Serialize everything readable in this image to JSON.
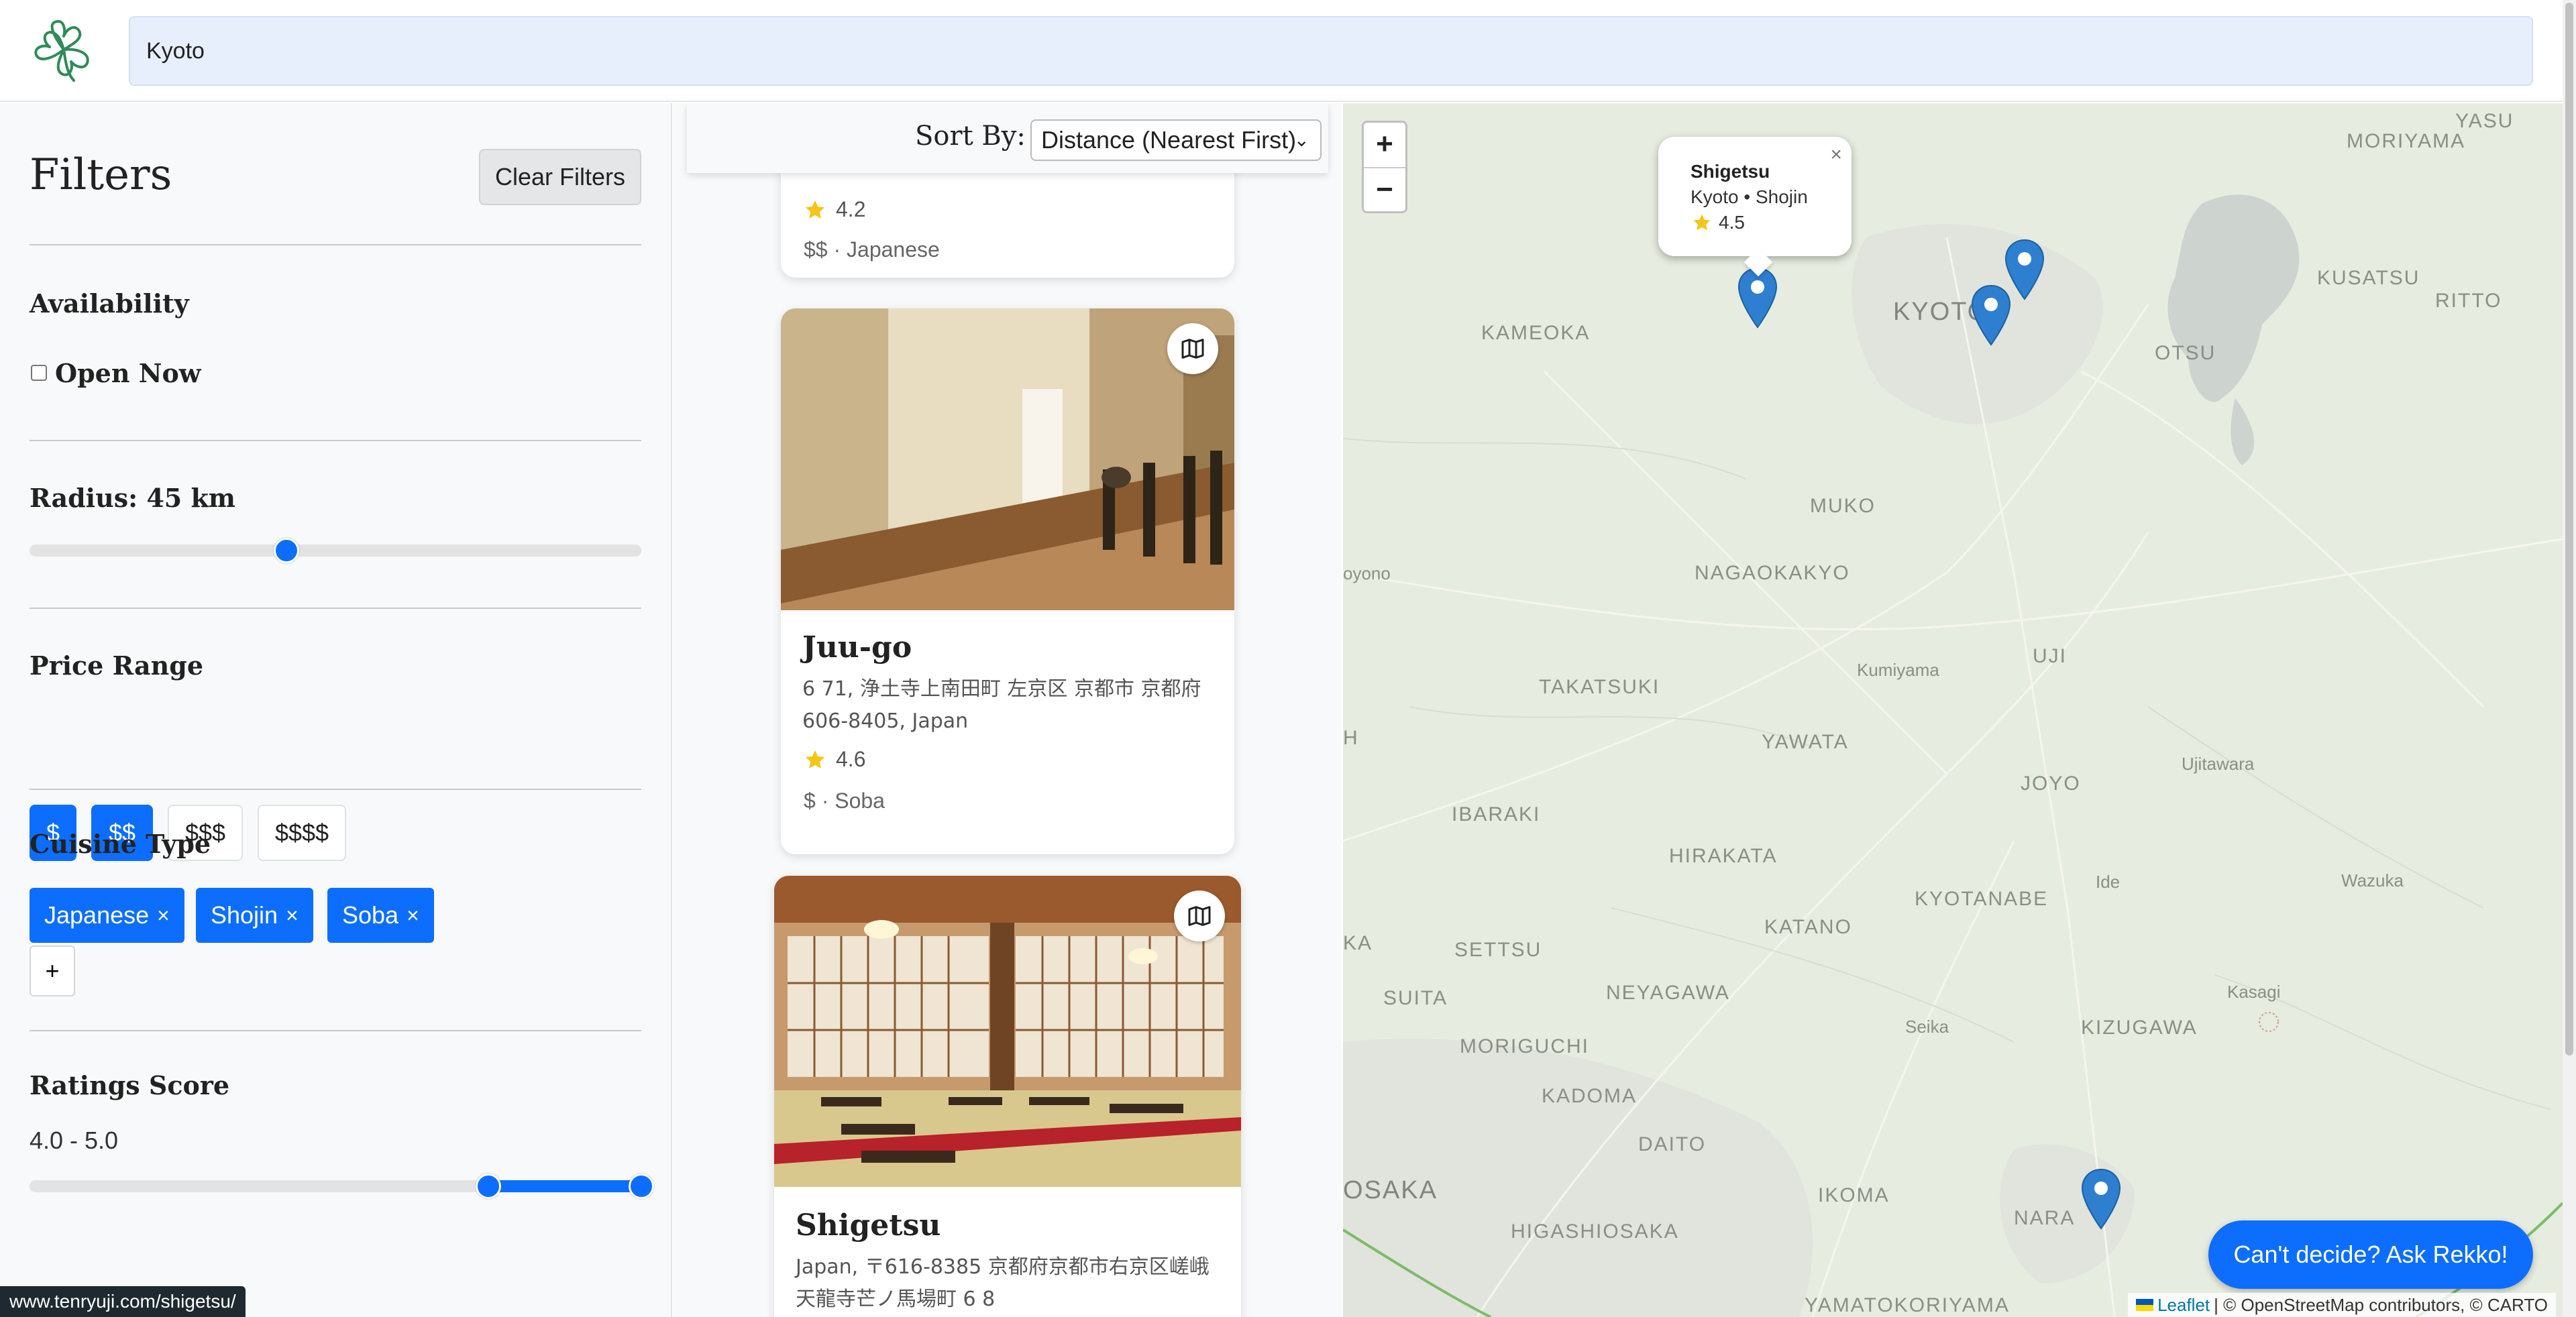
{
  "search": {
    "value": "Kyoto"
  },
  "filters": {
    "title": "Filters",
    "clear_label": "Clear Filters",
    "availability": {
      "title": "Availability",
      "open_now_label": "Open Now",
      "open_now_checked": false
    },
    "radius": {
      "title": "Radius: 45 km",
      "value_fraction": 0.42
    },
    "price": {
      "title": "Price Range",
      "options": [
        "$",
        "$$",
        "$$$",
        "$$$$"
      ],
      "selected": [
        "$",
        "$$"
      ]
    },
    "cuisine": {
      "title": "Cuisine Type",
      "chips": [
        "Japanese",
        "Shojin",
        "Soba"
      ],
      "remove_glyph": "×",
      "add_label": "+"
    },
    "rating": {
      "title": "Ratings Score",
      "range_text": "4.0 - 5.0",
      "min_fraction": 0.75,
      "max_fraction": 1.0
    }
  },
  "sort": {
    "label": "Sort By:",
    "selected": "Distance (Nearest First)"
  },
  "restaurants": [
    {
      "name": "",
      "rating": "4.2",
      "meta": "$$ · Japanese"
    },
    {
      "name": "Juu-go",
      "address": "6 71, 浄土寺上南田町 左京区 京都市 京都府 606-8405, Japan",
      "rating": "4.6",
      "meta": "$ · Soba"
    },
    {
      "name": "Shigetsu",
      "address": "Japan, 〒616-8385 京都府京都市右京区嵯峨天龍寺芒ノ馬場町 6 8"
    }
  ],
  "map": {
    "zoom_in": "+",
    "zoom_out": "−",
    "popup": {
      "name": "Shigetsu",
      "subtitle": "Kyoto • Shojin",
      "rating": "4.5",
      "close": "×"
    },
    "labels": [
      "YASU",
      "MORIYAMA",
      "KUSATSU",
      "RITTO",
      "OTSU",
      "KYOTO",
      "KAMEOKA",
      "MUKO",
      "NAGAOKAKYO",
      "Kumiyama",
      "UJI",
      "TAKATSUKI",
      "YAWATA",
      "JOYO",
      "Ujitawara",
      "IBARAKI",
      "HIRAKATA",
      "KYOTANABE",
      "Ide",
      "Wazuka",
      "KATANO",
      "SETTSU",
      "SUITA",
      "NEYAGAWA",
      "Seika",
      "KIZUGAWA",
      "Kasagi",
      "MORIGUCHI",
      "KADOMA",
      "DAITO",
      "OSAKA",
      "IKOMA",
      "HIGASHIOSAKA",
      "NARA",
      "YAMATOKORIYAMA",
      "oyono",
      "KA",
      "H"
    ],
    "ask_label": "Can't decide? Ask Rekko!",
    "attribution": {
      "leaflet": "Leaflet",
      "rest": "| © OpenStreetMap contributors, © CARTO"
    }
  },
  "status_url": "www.tenryuji.com/shigetsu/",
  "colors": {
    "accent": "#0d6efd",
    "sidebar_bg": "#f8f9fa",
    "search_bg": "#e8effc",
    "map_bg": "#e6ecdf",
    "marker": "#2f7fd0"
  }
}
